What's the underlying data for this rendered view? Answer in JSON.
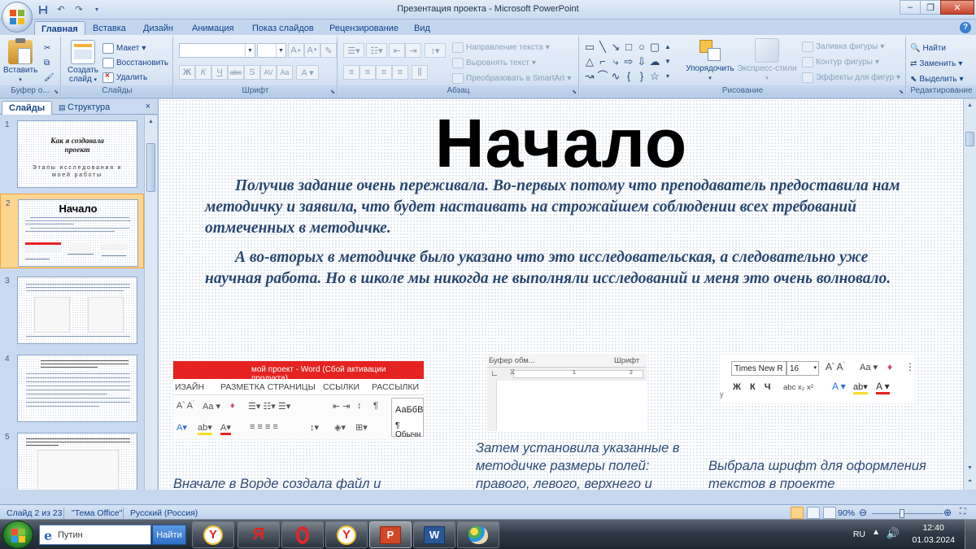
{
  "window": {
    "title": "Презентация проекта - Microsoft PowerPoint"
  },
  "tabs": [
    "Главная",
    "Вставка",
    "Дизайн",
    "Анимация",
    "Показ слайдов",
    "Рецензирование",
    "Вид"
  ],
  "ribbon": {
    "clipboard": {
      "paste": "Вставить",
      "label": "Буфер о..."
    },
    "slides": {
      "create": "Создать",
      "create2": "слайд",
      "layout": "Макет",
      "reset": "Восстановить",
      "delete": "Удалить",
      "label": "Слайды"
    },
    "font": {
      "label": "Шрифт",
      "bold": "Ж",
      "italic": "К",
      "underline": "Ч",
      "strike": "abc",
      "shadow": "S",
      "spacing": "AV",
      "case": "Aa"
    },
    "paragraph": {
      "label": "Абзац",
      "text_direction": "Направление текста",
      "align_text": "Выровнять текст",
      "smartart": "Преобразовать в SmartArt"
    },
    "drawing": {
      "label": "Рисование",
      "arrange": "Упорядочить",
      "quick_styles": "Экспресс-стили",
      "fill": "Заливка фигуры",
      "outline": "Контур фигуры",
      "effects": "Эффекты для фигур"
    },
    "editing": {
      "label": "Редактирование",
      "find": "Найти",
      "replace": "Заменить",
      "select": "Выделить"
    }
  },
  "panel": {
    "tab_slides": "Слайды",
    "tab_outline": "Структура",
    "close": "×",
    "thumbs": [
      {
        "num": "1",
        "title": "Как я создавала проект",
        "subtitle": "Этапы исследования и моей работы"
      },
      {
        "num": "2",
        "title": "Начало"
      },
      {
        "num": "3"
      },
      {
        "num": "4"
      },
      {
        "num": "5"
      }
    ]
  },
  "slide": {
    "title": "Начало",
    "para1": "Получив задание очень переживала. Во-первых потому что преподаватель предоставила нам методичку и заявила, что будет настаивать на строжайшем соблюдении всех требований отмеченных в методичке.",
    "para2": "А во-вторых в методичке было указано что это исследовательская, а следовательно уже научная работа. Но в школе мы никогда не выполняли исследований и меня это очень волновало.",
    "word_title": "мой проект -  Word (Сбой активации продукта)",
    "word_tabs": [
      "ИЗАЙН",
      "РАЗМЕТКА СТРАНИЦЫ",
      "ССЫЛКИ",
      "РАССЫЛКИ"
    ],
    "word_style": "АаБбВ",
    "word_style2": "¶ Обычн",
    "ruler_group1": "Буфер обм...",
    "ruler_group2": "Шрифт",
    "ruler_marks": [
      "1",
      "2"
    ],
    "font_name": "Times New R",
    "font_size": "16",
    "caption1": "Вначале в Ворде создала файл и",
    "caption2": "Затем установила указанные в методичке размеры полей: правого, левого, верхнего и",
    "caption3": "Выбрала шрифт для оформления текстов в проекте"
  },
  "status": {
    "slide_of": "Слайд 2 из 23",
    "theme": "\"Тема Office\"",
    "language": "Русский (Россия)",
    "zoom": "90%"
  },
  "taskbar": {
    "search_value": "Путин",
    "search_button": "Найти",
    "lang": "RU",
    "time": "12:40",
    "date": "01.03.2024"
  },
  "colors": {
    "accent": "#1e395b",
    "word_red": "#e52321",
    "slide_text": "#28476e"
  }
}
